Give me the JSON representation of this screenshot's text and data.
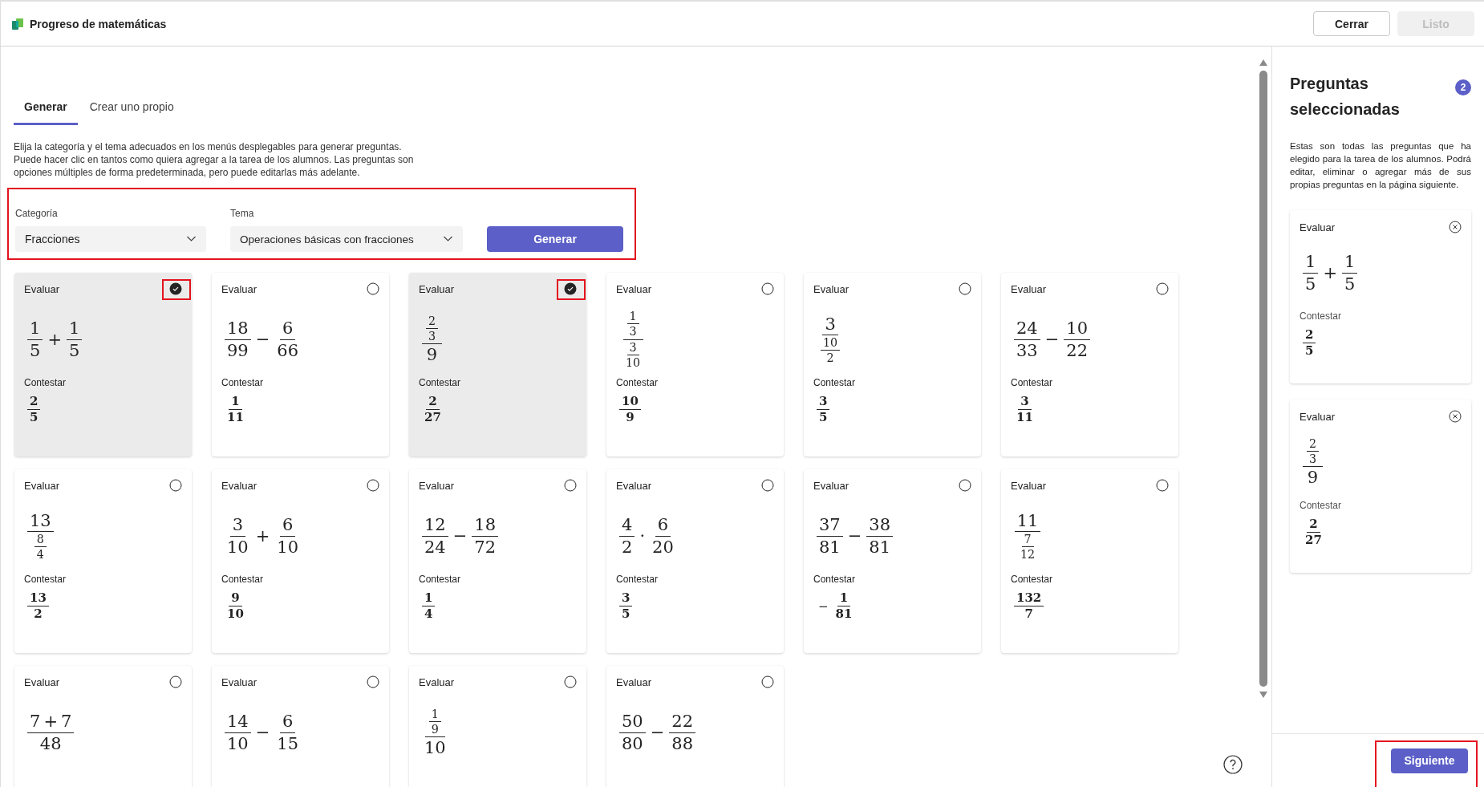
{
  "app": {
    "title": "Progreso de matemáticas"
  },
  "header_buttons": [
    {
      "label": "Cerrar",
      "disabled": false
    },
    {
      "label": "Listo",
      "disabled": true
    }
  ],
  "tabs": [
    {
      "label": "Generar",
      "selected": true
    },
    {
      "label": "Crear uno propio",
      "selected": false
    }
  ],
  "description": "Elija la categoría y el tema adecuados en los menús desplegables para generar preguntas. Puede hacer clic en tantos como quiera agregar a la tarea de los alumnos. Las preguntas son opciones múltiples de forma predeterminada, pero puede editarlas más adelante.",
  "selectors": {
    "highlighted": true,
    "fields": [
      {
        "label": "Categoría",
        "value": "Fracciones"
      },
      {
        "label": "Tema",
        "value": "Operaciones básicas con fracciones"
      }
    ],
    "button": "Generar"
  },
  "questions": [
    {
      "prompt_label": "Evaluar",
      "expression": [
        {
          "kind": "frac",
          "num": [
            "1"
          ],
          "den": [
            "5"
          ]
        },
        "+",
        {
          "kind": "frac",
          "num": [
            "1"
          ],
          "den": [
            "5"
          ]
        }
      ],
      "answer_label": "Contestar",
      "answer": [
        {
          "kind": "frac",
          "num": [
            "2"
          ],
          "den": [
            "5"
          ]
        }
      ],
      "selected": true,
      "highlighted": true
    },
    {
      "prompt_label": "Evaluar",
      "expression": [
        {
          "kind": "frac",
          "num": [
            "18"
          ],
          "den": [
            "99"
          ]
        },
        "−",
        {
          "kind": "frac",
          "num": [
            "6"
          ],
          "den": [
            "66"
          ]
        }
      ],
      "answer_label": "Contestar",
      "answer": [
        {
          "kind": "frac",
          "num": [
            "1"
          ],
          "den": [
            "11"
          ]
        }
      ],
      "selected": false,
      "highlighted": false
    },
    {
      "prompt_label": "Evaluar",
      "expression": [
        {
          "kind": "frac",
          "num": [
            {
              "kind": "frac",
              "num": [
                "2"
              ],
              "den": [
                "3"
              ]
            }
          ],
          "den": [
            "9"
          ]
        }
      ],
      "answer_label": "Contestar",
      "answer": [
        {
          "kind": "frac",
          "num": [
            "2"
          ],
          "den": [
            "27"
          ]
        }
      ],
      "selected": true,
      "highlighted": true
    },
    {
      "prompt_label": "Evaluar",
      "expression": [
        {
          "kind": "frac",
          "num": [
            {
              "kind": "frac",
              "num": [
                "1"
              ],
              "den": [
                "3"
              ]
            }
          ],
          "den": [
            {
              "kind": "frac",
              "num": [
                "3"
              ],
              "den": [
                "10"
              ]
            }
          ]
        }
      ],
      "answer_label": "Contestar",
      "answer": [
        {
          "kind": "frac",
          "num": [
            "10"
          ],
          "den": [
            "9"
          ]
        }
      ],
      "selected": false,
      "highlighted": false
    },
    {
      "prompt_label": "Evaluar",
      "expression": [
        {
          "kind": "frac",
          "num": [
            "3"
          ],
          "den": [
            {
              "kind": "frac",
              "num": [
                "10"
              ],
              "den": [
                "2"
              ]
            }
          ]
        }
      ],
      "answer_label": "Contestar",
      "answer": [
        {
          "kind": "frac",
          "num": [
            "3"
          ],
          "den": [
            "5"
          ]
        }
      ],
      "selected": false,
      "highlighted": false
    },
    {
      "prompt_label": "Evaluar",
      "expression": [
        {
          "kind": "frac",
          "num": [
            "24"
          ],
          "den": [
            "33"
          ]
        },
        "−",
        {
          "kind": "frac",
          "num": [
            "10"
          ],
          "den": [
            "22"
          ]
        }
      ],
      "answer_label": "Contestar",
      "answer": [
        {
          "kind": "frac",
          "num": [
            "3"
          ],
          "den": [
            "11"
          ]
        }
      ],
      "selected": false,
      "highlighted": false
    },
    {
      "prompt_label": "Evaluar",
      "expression": [
        {
          "kind": "frac",
          "num": [
            "13"
          ],
          "den": [
            {
              "kind": "frac",
              "num": [
                "8"
              ],
              "den": [
                "4"
              ]
            }
          ]
        }
      ],
      "answer_label": "Contestar",
      "answer": [
        {
          "kind": "frac",
          "num": [
            "13"
          ],
          "den": [
            "2"
          ]
        }
      ],
      "selected": false,
      "highlighted": false
    },
    {
      "prompt_label": "Evaluar",
      "expression": [
        {
          "kind": "frac",
          "num": [
            "3"
          ],
          "den": [
            "10"
          ]
        },
        "+",
        {
          "kind": "frac",
          "num": [
            "6"
          ],
          "den": [
            "10"
          ]
        }
      ],
      "answer_label": "Contestar",
      "answer": [
        {
          "kind": "frac",
          "num": [
            "9"
          ],
          "den": [
            "10"
          ]
        }
      ],
      "selected": false,
      "highlighted": false
    },
    {
      "prompt_label": "Evaluar",
      "expression": [
        {
          "kind": "frac",
          "num": [
            "12"
          ],
          "den": [
            "24"
          ]
        },
        "−",
        {
          "kind": "frac",
          "num": [
            "18"
          ],
          "den": [
            "72"
          ]
        }
      ],
      "answer_label": "Contestar",
      "answer": [
        {
          "kind": "frac",
          "num": [
            "1"
          ],
          "den": [
            "4"
          ]
        }
      ],
      "selected": false,
      "highlighted": false
    },
    {
      "prompt_label": "Evaluar",
      "expression": [
        {
          "kind": "frac",
          "num": [
            "4"
          ],
          "den": [
            "2"
          ]
        },
        "·",
        {
          "kind": "frac",
          "num": [
            "6"
          ],
          "den": [
            "20"
          ]
        }
      ],
      "answer_label": "Contestar",
      "answer": [
        {
          "kind": "frac",
          "num": [
            "3"
          ],
          "den": [
            "5"
          ]
        }
      ],
      "selected": false,
      "highlighted": false
    },
    {
      "prompt_label": "Evaluar",
      "expression": [
        {
          "kind": "frac",
          "num": [
            "37"
          ],
          "den": [
            "81"
          ]
        },
        "−",
        {
          "kind": "frac",
          "num": [
            "38"
          ],
          "den": [
            "81"
          ]
        }
      ],
      "answer_label": "Contestar",
      "answer": [
        "−",
        {
          "kind": "frac",
          "num": [
            "1"
          ],
          "den": [
            "81"
          ]
        }
      ],
      "selected": false,
      "highlighted": false
    },
    {
      "prompt_label": "Evaluar",
      "expression": [
        {
          "kind": "frac",
          "num": [
            "11"
          ],
          "den": [
            {
              "kind": "frac",
              "num": [
                "7"
              ],
              "den": [
                "12"
              ]
            }
          ]
        }
      ],
      "answer_label": "Contestar",
      "answer": [
        {
          "kind": "frac",
          "num": [
            "132"
          ],
          "den": [
            "7"
          ]
        }
      ],
      "selected": false,
      "highlighted": false
    },
    {
      "prompt_label": "Evaluar",
      "expression": [
        {
          "kind": "frac",
          "num": [
            "7",
            "+",
            "7"
          ],
          "den": [
            "48"
          ]
        }
      ],
      "selected": false,
      "highlighted": false
    },
    {
      "prompt_label": "Evaluar",
      "expression": [
        {
          "kind": "frac",
          "num": [
            "14"
          ],
          "den": [
            "10"
          ]
        },
        "−",
        {
          "kind": "frac",
          "num": [
            "6"
          ],
          "den": [
            "15"
          ]
        }
      ],
      "selected": false,
      "highlighted": false
    },
    {
      "prompt_label": "Evaluar",
      "expression": [
        {
          "kind": "frac",
          "num": [
            {
              "kind": "frac",
              "num": [
                "1"
              ],
              "den": [
                "9"
              ]
            }
          ],
          "den": [
            "10"
          ]
        }
      ],
      "selected": false,
      "highlighted": false
    },
    {
      "prompt_label": "Evaluar",
      "expression": [
        {
          "kind": "frac",
          "num": [
            "50"
          ],
          "den": [
            "80"
          ]
        },
        "−",
        {
          "kind": "frac",
          "num": [
            "22"
          ],
          "den": [
            "88"
          ]
        }
      ],
      "selected": false,
      "highlighted": false
    }
  ],
  "selected_panel": {
    "title": "Preguntas seleccionadas",
    "count": "2",
    "description": "Estas son todas las preguntas que ha elegido para la tarea de los alumnos. Podrá editar, eliminar o agregar más de sus propias preguntas en la página siguiente.",
    "items": [
      {
        "prompt_label": "Evaluar",
        "expression": [
          {
            "kind": "frac",
            "num": [
              "1"
            ],
            "den": [
              "5"
            ]
          },
          "+",
          {
            "kind": "frac",
            "num": [
              "1"
            ],
            "den": [
              "5"
            ]
          }
        ],
        "answer_label": "Contestar",
        "answer": [
          {
            "kind": "frac",
            "num": [
              "2"
            ],
            "den": [
              "5"
            ]
          }
        ]
      },
      {
        "prompt_label": "Evaluar",
        "expression": [
          {
            "kind": "frac",
            "num": [
              {
                "kind": "frac",
                "num": [
                  "2"
                ],
                "den": [
                  "3"
                ]
              }
            ],
            "den": [
              "9"
            ]
          }
        ],
        "answer_label": "Contestar",
        "answer": [
          {
            "kind": "frac",
            "num": [
              "2"
            ],
            "den": [
              "27"
            ]
          }
        ]
      }
    ]
  },
  "footer": {
    "button": "Siguiente",
    "highlighted": true
  }
}
